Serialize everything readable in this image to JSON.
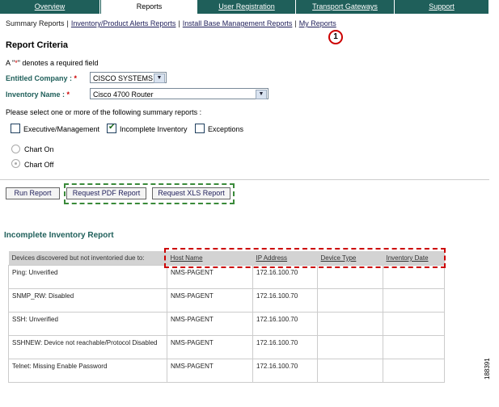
{
  "tabs": [
    "Overview",
    "Reports",
    "User Registration",
    "Transport Gateways",
    "Support"
  ],
  "active_tab": "Reports",
  "subnav": {
    "current": "Summary Reports",
    "links": [
      "Inventory/Product Alerts Reports",
      "Install Base Management Reports",
      "My Reports"
    ]
  },
  "callout": "1",
  "criteria": {
    "title": "Report Criteria",
    "required_note_a": "A \"",
    "required_note_star": "*",
    "required_note_b": "\" denotes a required field",
    "company_label": "Entitled Company :",
    "company_value": "CISCO SYSTEMS",
    "inventory_label": "Inventory Name :",
    "inventory_value": "Cisco 4700 Router",
    "required_star": "*",
    "prompt": "Please select one or more of the following summary reports :",
    "checkboxes": [
      {
        "label": "Executive/Management",
        "checked": false
      },
      {
        "label": "Incomplete Inventory",
        "checked": true
      },
      {
        "label": "Exceptions",
        "checked": false
      }
    ],
    "radios": [
      {
        "label": "Chart On",
        "selected": false
      },
      {
        "label": "Chart Off",
        "selected": true
      }
    ]
  },
  "buttons": {
    "run": "Run Report",
    "pdf": "Request PDF Report",
    "xls": "Request XLS Report"
  },
  "report": {
    "title": "Incomplete Inventory Report",
    "columns": [
      "Devices discovered but not inventoried due to:",
      "Host Name",
      "IP Address",
      "Device Type",
      "Inventory Date"
    ],
    "rows": [
      [
        "Ping: Unverified",
        "NMS-PAGENT",
        "172.16.100.70",
        "",
        ""
      ],
      [
        "SNMP_RW: Disabled",
        "NMS-PAGENT",
        "172.16.100.70",
        "",
        ""
      ],
      [
        "SSH: Unverified",
        "NMS-PAGENT",
        "172.16.100.70",
        "",
        ""
      ],
      [
        "SSHNEW: Device not reachable/Protocol Disabled",
        "NMS-PAGENT",
        "172.16.100.70",
        "",
        ""
      ],
      [
        "Telnet: Missing Enable Password",
        "NMS-PAGENT",
        "172.16.100.70",
        "",
        ""
      ]
    ]
  },
  "figure_number": "188391"
}
